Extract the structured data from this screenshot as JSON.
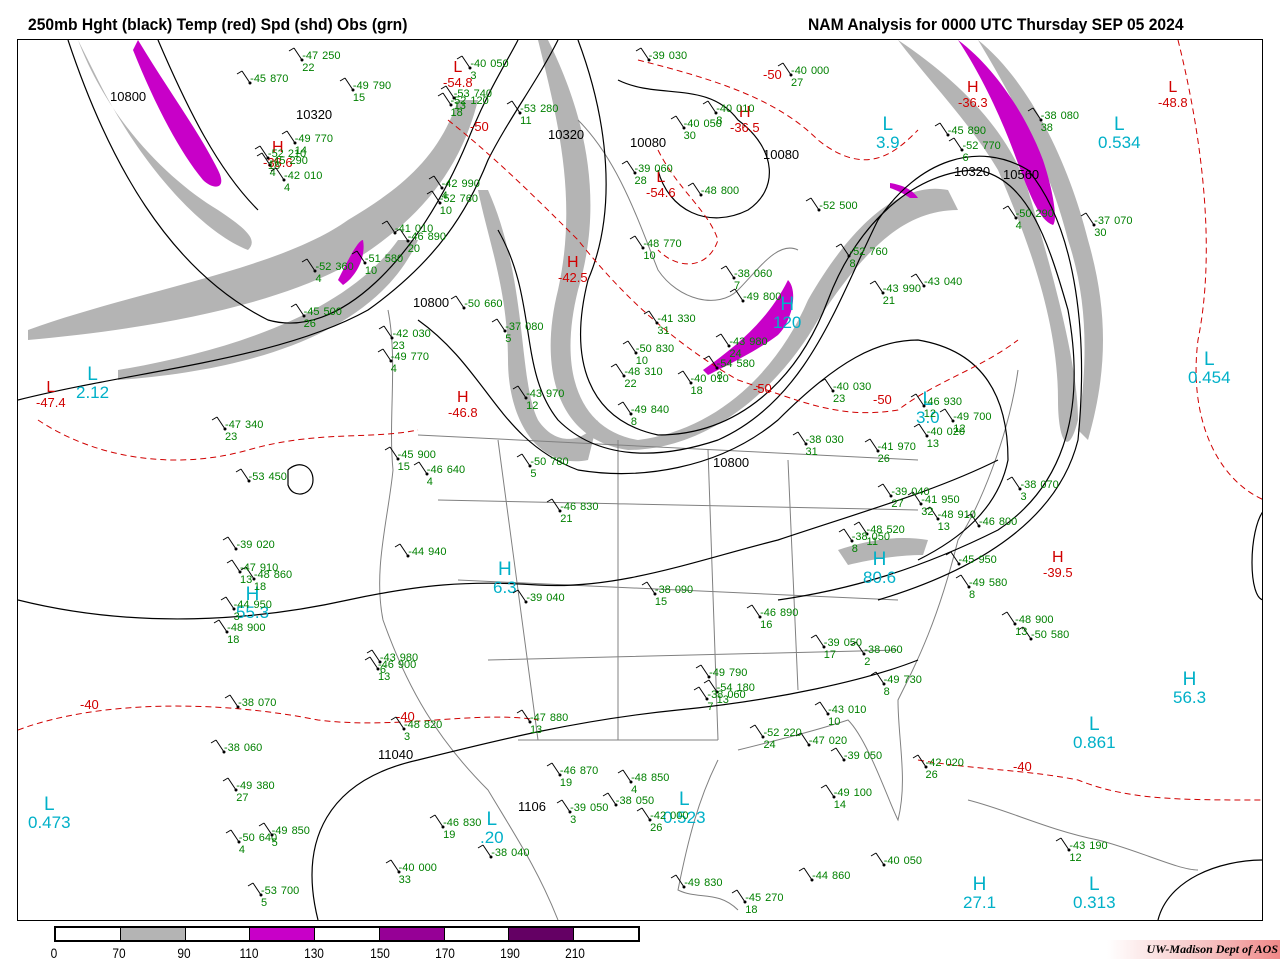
{
  "header": {
    "title": "250mb Hght (black) Temp (red) Spd (shd) Obs (grn)",
    "analysis": "NAM Analysis for 0000 UTC Thursday  SEP 05 2024"
  },
  "colors": {
    "height": "#000000",
    "temperature": "#d00000",
    "observations": "#008000",
    "speed_label": "#00b0c8",
    "speed_70_90": "#b4b4b4",
    "speed_110_130": "#c800c8",
    "speed_150_170": "#960096",
    "speed_190_210": "#640064"
  },
  "legend": {
    "ticks": [
      "0",
      "70",
      "90",
      "110",
      "130",
      "150",
      "170",
      "190",
      "210"
    ],
    "bins": [
      {
        "range": "0-70",
        "color": "#ffffff"
      },
      {
        "range": "70-90",
        "color": "#b4b4b4"
      },
      {
        "range": "90-110",
        "color": "#ffffff"
      },
      {
        "range": "110-130",
        "color": "#c800c8"
      },
      {
        "range": "130-150",
        "color": "#ffffff"
      },
      {
        "range": "150-170",
        "color": "#960096"
      },
      {
        "range": "170-190",
        "color": "#ffffff"
      },
      {
        "range": "190-210",
        "color": "#640064"
      },
      {
        "range": "210+",
        "color": "#ffffff"
      }
    ]
  },
  "credit": "UW-Madison   Dept of AOS",
  "speed_centers": [
    {
      "type": "L",
      "value": "2.12"
    },
    {
      "type": "L",
      "value": "0.473"
    },
    {
      "type": "H",
      "value": "55.3"
    },
    {
      "type": "L",
      "value": ".20"
    },
    {
      "type": "H",
      "value": "6.3"
    },
    {
      "type": "L",
      "value": "0.523"
    },
    {
      "type": "L",
      "value": "0.861"
    },
    {
      "type": "H",
      "value": "56.3"
    },
    {
      "type": "L",
      "value": "0.313"
    },
    {
      "type": "H",
      "value": "27.1"
    },
    {
      "type": "L",
      "value": "0.534"
    },
    {
      "type": "L",
      "value": "0.454"
    },
    {
      "type": "L",
      "value": "3.0"
    },
    {
      "type": "L",
      "value": "3.9"
    },
    {
      "type": "H",
      "value": "80.6"
    },
    {
      "type": "H",
      "value": "120"
    }
  ],
  "temp_centers": [
    {
      "type": "H",
      "value": "-46.8"
    },
    {
      "type": "H",
      "value": "-38.6"
    },
    {
      "type": "H",
      "value": "-39.5"
    },
    {
      "type": "H",
      "value": "-36.5"
    },
    {
      "type": "H",
      "value": "-42.5"
    },
    {
      "type": "H",
      "value": "-36.3"
    },
    {
      "type": "L",
      "value": "-48.8"
    },
    {
      "type": "L",
      "value": "-47.4"
    },
    {
      "type": "L",
      "value": "-54.8"
    },
    {
      "type": "L",
      "value": "-54.6"
    }
  ],
  "height_labels": [
    "10800",
    "10320",
    "10320",
    "10080",
    "10080",
    "10320",
    "10560",
    "10800",
    "10800",
    "11040",
    "1106"
  ],
  "temp_labels": [
    "-50",
    "-50",
    "-50",
    "-50",
    "-40",
    "-40",
    "-40"
  ],
  "observations": [
    {
      "t": "-47",
      "h": "250",
      "d": "22"
    },
    {
      "t": "-53",
      "h": "280",
      "d": "11"
    },
    {
      "t": "-45",
      "h": "290",
      "d": "4"
    },
    {
      "t": "-50",
      "h": "290",
      "d": "4"
    },
    {
      "t": "-52",
      "h": "360",
      "d": "4"
    },
    {
      "t": "-41",
      "h": "330",
      "d": "31"
    },
    {
      "t": "-48",
      "h": "310",
      "d": "22"
    },
    {
      "t": "-47",
      "h": "340",
      "d": "23"
    },
    {
      "t": "-53",
      "h": "450",
      "d": ""
    },
    {
      "t": "-48",
      "h": "520",
      "d": "11"
    },
    {
      "t": "-49",
      "h": "580",
      "d": "8"
    },
    {
      "t": "-50",
      "h": "580",
      "d": ""
    },
    {
      "t": "-54",
      "h": "180",
      "d": "13"
    },
    {
      "t": "-47",
      "h": "020",
      "d": ""
    },
    {
      "t": "-49",
      "h": "100",
      "d": "14"
    },
    {
      "t": "-43",
      "h": "190",
      "d": "12"
    },
    {
      "t": "-45",
      "h": "270",
      "d": "18"
    },
    {
      "t": "-52",
      "h": "120",
      "d": "18"
    },
    {
      "t": "-52",
      "h": "210",
      "d": "18"
    },
    {
      "t": "-52",
      "h": "500",
      "d": ""
    },
    {
      "t": "-51",
      "h": "580",
      "d": "10"
    },
    {
      "t": "-45",
      "h": "500",
      "d": "26"
    },
    {
      "t": "-54",
      "h": "580",
      "d": "8"
    },
    {
      "t": "-49",
      "h": "700",
      "d": "12"
    },
    {
      "t": "-46",
      "h": "640",
      "d": "4"
    },
    {
      "t": "-46",
      "h": "800",
      "d": ""
    },
    {
      "t": "-48",
      "h": "860",
      "d": "18"
    },
    {
      "t": "-48",
      "h": "900",
      "d": "18"
    },
    {
      "t": "-49",
      "h": "730",
      "d": "8"
    },
    {
      "t": "-52",
      "h": "220",
      "d": "24"
    },
    {
      "t": "-49",
      "h": "380",
      "d": "27"
    },
    {
      "t": "-50",
      "h": "640",
      "d": "4"
    },
    {
      "t": "-53",
      "h": "700",
      "d": "5"
    },
    {
      "t": "-53",
      "h": "740",
      "d": "13"
    },
    {
      "t": "-52",
      "h": "770",
      "d": "6"
    },
    {
      "t": "-52",
      "h": "760",
      "d": "10"
    },
    {
      "t": "-52",
      "h": "760",
      "d": "8"
    },
    {
      "t": "-50",
      "h": "660",
      "d": ""
    },
    {
      "t": "-49",
      "h": "770",
      "d": "4"
    },
    {
      "t": "-49",
      "h": "840",
      "d": "8"
    },
    {
      "t": "-50",
      "h": "780",
      "d": "5"
    },
    {
      "t": "-48",
      "h": "910",
      "d": "13"
    },
    {
      "t": "-47",
      "h": "910",
      "d": "13"
    },
    {
      "t": "-48",
      "h": "900",
      "d": "13"
    },
    {
      "t": "-49",
      "h": "790",
      "d": ""
    },
    {
      "t": "-48",
      "h": "820",
      "d": "3"
    },
    {
      "t": "-48",
      "h": "850",
      "d": "4"
    },
    {
      "t": "-49",
      "h": "850",
      "d": "5"
    },
    {
      "t": "-49",
      "h": "830",
      "d": ""
    },
    {
      "t": "-49",
      "h": "790",
      "d": "15"
    },
    {
      "t": "-49",
      "h": "770",
      "d": "14"
    },
    {
      "t": "-48",
      "h": "800",
      "d": ""
    },
    {
      "t": "-48",
      "h": "770",
      "d": "10"
    },
    {
      "t": "-49",
      "h": "800",
      "d": ""
    },
    {
      "t": "-50",
      "h": "830",
      "d": "10"
    },
    {
      "t": "-46",
      "h": "930",
      "d": "12"
    },
    {
      "t": "-45",
      "h": "900",
      "d": "15"
    },
    {
      "t": "-46",
      "h": "830",
      "d": "21"
    },
    {
      "t": "-45",
      "h": "950",
      "d": ""
    },
    {
      "t": "-46",
      "h": "890",
      "d": "16"
    },
    {
      "t": "-46",
      "h": "900",
      "d": "13"
    },
    {
      "t": "-47",
      "h": "880",
      "d": "13"
    },
    {
      "t": "-46",
      "h": "870",
      "d": "19"
    },
    {
      "t": "-46",
      "h": "830",
      "d": "19"
    },
    {
      "t": "-44",
      "h": "860",
      "d": ""
    },
    {
      "t": "-45",
      "h": "870",
      "d": ""
    },
    {
      "t": "-45",
      "h": "890",
      "d": ""
    },
    {
      "t": "-42",
      "h": "990",
      "d": "4"
    },
    {
      "t": "-46",
      "h": "890",
      "d": "20"
    },
    {
      "t": "-43",
      "h": "990",
      "d": "21"
    },
    {
      "t": "-43",
      "h": "980",
      "d": "24"
    },
    {
      "t": "-43",
      "h": "970",
      "d": "12"
    },
    {
      "t": "-41",
      "h": "970",
      "d": "26"
    },
    {
      "t": "-41",
      "h": "950",
      "d": "32"
    },
    {
      "t": "-44",
      "h": "940",
      "d": ""
    },
    {
      "t": "-44",
      "h": "950",
      "d": "3"
    },
    {
      "t": "-43",
      "h": "980",
      "d": "6"
    },
    {
      "t": "-43",
      "h": "010",
      "d": "10"
    },
    {
      "t": "-42",
      "h": "020",
      "d": "26"
    },
    {
      "t": "-42",
      "h": "000",
      "d": "26"
    },
    {
      "t": "-40",
      "h": "000",
      "d": "33"
    },
    {
      "t": "-40",
      "h": "000",
      "d": "27"
    },
    {
      "t": "-40",
      "h": "050",
      "d": "30"
    },
    {
      "t": "-42",
      "h": "010",
      "d": "4"
    },
    {
      "t": "-41",
      "h": "010",
      "d": ""
    },
    {
      "t": "-43",
      "h": "040",
      "d": ""
    },
    {
      "t": "-42",
      "h": "030",
      "d": "23"
    },
    {
      "t": "-40",
      "h": "030",
      "d": "23"
    },
    {
      "t": "-38",
      "h": "030",
      "d": "31"
    },
    {
      "t": "-39",
      "h": "040",
      "d": "27"
    },
    {
      "t": "-39",
      "h": "020",
      "d": ""
    },
    {
      "t": "-39",
      "h": "040",
      "d": ""
    },
    {
      "t": "-38",
      "h": "060",
      "d": "2"
    },
    {
      "t": "-38",
      "h": "070",
      "d": ""
    },
    {
      "t": "-39",
      "h": "050",
      "d": ""
    },
    {
      "t": "-39",
      "h": "050",
      "d": "3"
    },
    {
      "t": "-40",
      "h": "050",
      "d": ""
    },
    {
      "t": "-40",
      "h": "050",
      "d": "3"
    },
    {
      "t": "-38",
      "h": "080",
      "d": "38"
    },
    {
      "t": "-39",
      "h": "060",
      "d": "28"
    },
    {
      "t": "-37",
      "h": "070",
      "d": "30"
    },
    {
      "t": "-38",
      "h": "060",
      "d": "7"
    },
    {
      "t": "-37",
      "h": "080",
      "d": "5"
    },
    {
      "t": "-40",
      "h": "010",
      "d": "18"
    },
    {
      "t": "-40",
      "h": "020",
      "d": "13"
    },
    {
      "t": "-38",
      "h": "070",
      "d": "3"
    },
    {
      "t": "-38",
      "h": "050",
      "d": "8"
    },
    {
      "t": "-38",
      "h": "090",
      "d": "15"
    },
    {
      "t": "-39",
      "h": "050",
      "d": "17"
    },
    {
      "t": "-38",
      "h": "060",
      "d": "7"
    },
    {
      "t": "-38",
      "h": "060",
      "d": ""
    },
    {
      "t": "-38",
      "h": "050",
      "d": ""
    },
    {
      "t": "-38",
      "h": "040",
      "d": ""
    },
    {
      "t": "-39",
      "h": "030",
      "d": ""
    },
    {
      "t": "-40",
      "h": "010",
      "d": "8"
    }
  ]
}
